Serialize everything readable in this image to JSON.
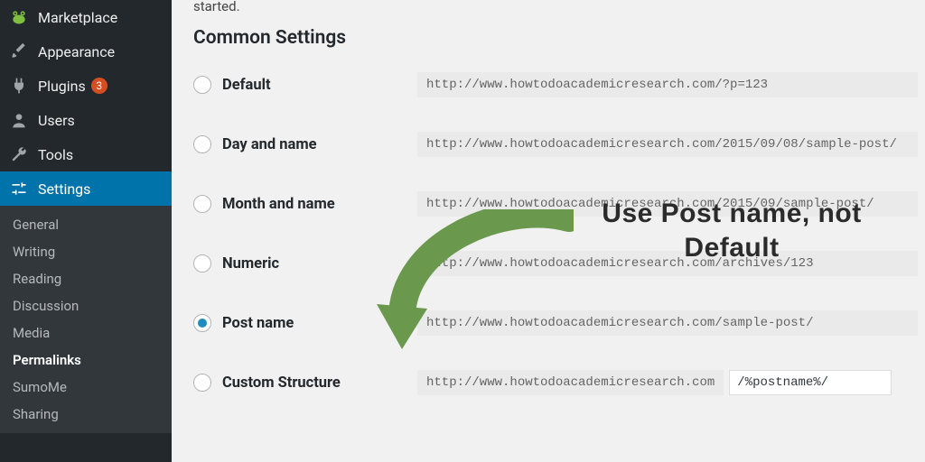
{
  "sidebar": {
    "items": [
      {
        "label": "Marketplace",
        "icon": "frog"
      },
      {
        "label": "Appearance",
        "icon": "brush"
      },
      {
        "label": "Plugins",
        "icon": "plug",
        "badge": "3"
      },
      {
        "label": "Users",
        "icon": "users"
      },
      {
        "label": "Tools",
        "icon": "wrench"
      },
      {
        "label": "Settings",
        "icon": "sliders",
        "active": true
      }
    ],
    "submenu": [
      {
        "label": "General"
      },
      {
        "label": "Writing"
      },
      {
        "label": "Reading"
      },
      {
        "label": "Discussion"
      },
      {
        "label": "Media"
      },
      {
        "label": "Permalinks",
        "current": true
      },
      {
        "label": "SumoMe"
      },
      {
        "label": "Sharing"
      }
    ]
  },
  "main": {
    "started_fragment": "started.",
    "section_title": "Common Settings",
    "options": [
      {
        "label": "Default",
        "url": "http://www.howtodoacademicresearch.com/?p=123"
      },
      {
        "label": "Day and name",
        "url": "http://www.howtodoacademicresearch.com/2015/09/08/sample-post/"
      },
      {
        "label": "Month and name",
        "url": "http://www.howtodoacademicresearch.com/2015/09/sample-post/"
      },
      {
        "label": "Numeric",
        "url": "http://www.howtodoacademicresearch.com/archives/123"
      },
      {
        "label": "Post name",
        "url": "http://www.howtodoacademicresearch.com/sample-post/",
        "checked": true
      }
    ],
    "custom": {
      "label": "Custom Structure",
      "prefix": "http://www.howtodoacademicresearch.com",
      "value": "/%postname%/"
    }
  },
  "annotation": {
    "text_line1": "Use Post name, not",
    "text_line2": "Default",
    "arrow_color": "#6a994e"
  }
}
